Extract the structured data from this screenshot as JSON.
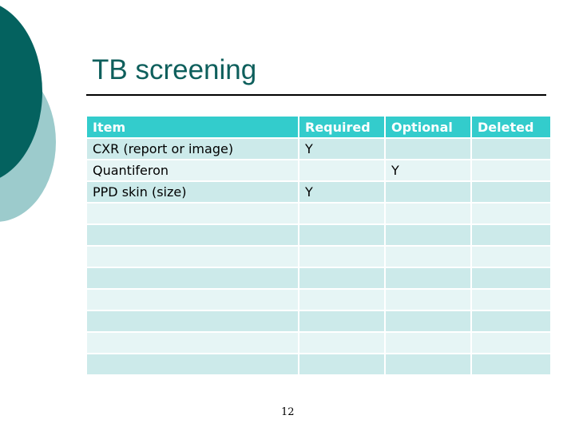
{
  "slide": {
    "title": "TB screening",
    "page_number": "12"
  },
  "table": {
    "headers": [
      "Item",
      "Required",
      "Optional",
      "Deleted"
    ],
    "rows": [
      [
        "CXR (report or image)",
        "Y",
        "",
        ""
      ],
      [
        "Quantiferon",
        "",
        "Y",
        ""
      ],
      [
        "PPD skin (size)",
        "Y",
        "",
        ""
      ],
      [
        "",
        "",
        "",
        ""
      ],
      [
        "",
        "",
        "",
        ""
      ],
      [
        "",
        "",
        "",
        ""
      ],
      [
        "",
        "",
        "",
        ""
      ],
      [
        "",
        "",
        "",
        ""
      ],
      [
        "",
        "",
        "",
        ""
      ],
      [
        "",
        "",
        "",
        ""
      ],
      [
        "",
        "",
        "",
        ""
      ]
    ]
  },
  "colors": {
    "header_bg": "#33cccc",
    "row_odd": "#cceaea",
    "row_even": "#e6f5f5",
    "title": "#0e5f5c",
    "accent_dark": "#04625f",
    "accent_light": "#9ccbcc"
  }
}
